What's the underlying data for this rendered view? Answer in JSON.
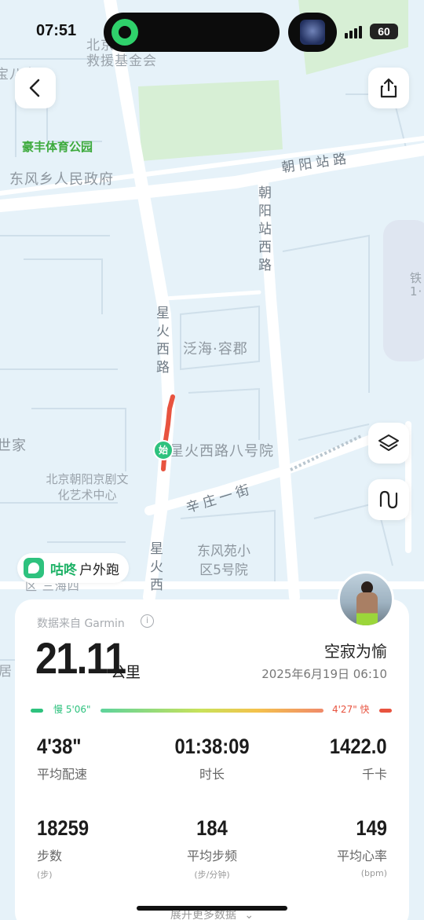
{
  "status_bar": {
    "time": "07:51",
    "battery": "60"
  },
  "map": {
    "labels": {
      "bj_top": "北京",
      "rescue_fund": "救援基金会",
      "baojia": "宝八京",
      "haofeng_park": "豪丰体育公园",
      "dongfeng_gov": "东风乡人民政府",
      "chaoyang_station_road": "朝阳站路",
      "chaoyang_station_west": "朝阳站西路",
      "xinghuo_west_upper": "星火西路",
      "fanhai_rongjun": "泛海·容郡",
      "xinghuo_8": "星火西路八号院",
      "shijia": "世家",
      "jingju_center": "北京朝阳京剧文化艺术中心",
      "xinzhuang_1": "辛庄一街",
      "xinghuo_west_lower": "星火西",
      "dongfengyuan": "东风苑小区5号院",
      "tie": "铁",
      "tie_sub": "1·",
      "ju": "居",
      "lower_left_1": "区 三海四"
    },
    "start_marker": "始"
  },
  "brand": {
    "name": "咕咚",
    "sub": "户外跑"
  },
  "summary": {
    "source": "数据来自 Garmin",
    "distance": "21.11",
    "distance_unit": "公里",
    "user_name": "空寂为愉",
    "date": "2025年6月19日 06:10",
    "pace_slow_label": "慢 5'06\"",
    "pace_fast_label": "4'27\" 快",
    "stats": [
      {
        "value": "4'38\"",
        "label": "平均配速",
        "unit": ""
      },
      {
        "value": "01:38:09",
        "label": "时长",
        "unit": ""
      },
      {
        "value": "1422.0",
        "label": "千卡",
        "unit": ""
      },
      {
        "value": "18259",
        "label": "步数",
        "unit": "(步)"
      },
      {
        "value": "184",
        "label": "平均步频",
        "unit": "(步/分钟)"
      },
      {
        "value": "149",
        "label": "平均心率",
        "unit": "(bpm)"
      }
    ],
    "more_label": "展开更多数据"
  },
  "colors": {
    "route": "#e8533f",
    "accent_green": "#2ec27e",
    "pace_slow": "#2ec27e",
    "pace_fast": "#e8533f"
  }
}
